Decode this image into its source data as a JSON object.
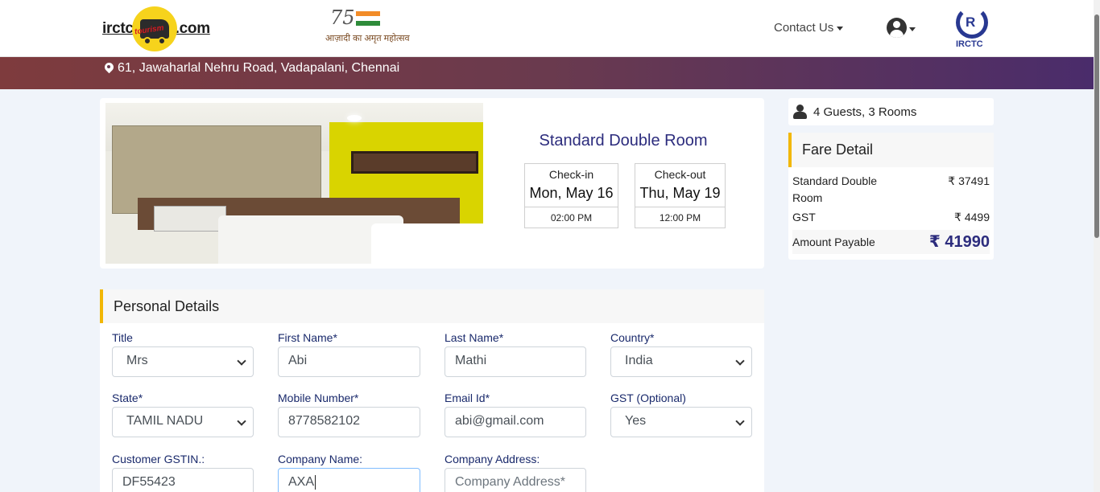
{
  "header": {
    "logo_left": {
      "prefix": "irctc",
      "suffix": ".com",
      "circle_word": "tourism"
    },
    "logo_azadi": {
      "number": "75",
      "caption": "आज़ादी का अमृत महोत्सव"
    },
    "contact_label": "Contact Us",
    "logo_right_label": "IRCTC",
    "logo_right_mark": "R"
  },
  "address": "61, Jawaharlal Nehru Road, Vadapalani, Chennai",
  "room": {
    "title": "Standard Double Room",
    "checkin": {
      "label": "Check-in",
      "date": "Mon, May 16",
      "time": "02:00 PM"
    },
    "checkout": {
      "label": "Check-out",
      "date": "Thu, May 19",
      "time": "12:00 PM"
    }
  },
  "guests": "4 Guests, 3 Rooms",
  "fare": {
    "title": "Fare Detail",
    "rows": [
      {
        "label": "Standard Double Room",
        "value": "₹ 37491"
      },
      {
        "label": "GST",
        "value": "₹ 4499"
      }
    ],
    "total_label": "Amount Payable",
    "total_value": "₹ 41990"
  },
  "personal": {
    "title": "Personal Details",
    "fields": {
      "title": {
        "label": "Title",
        "value": "Mrs"
      },
      "first_name": {
        "label": "First Name*",
        "value": "Abi"
      },
      "last_name": {
        "label": "Last Name*",
        "value": "Mathi"
      },
      "country": {
        "label": "Country*",
        "value": "India"
      },
      "state": {
        "label": "State*",
        "value": "TAMIL NADU"
      },
      "mobile": {
        "label": "Mobile Number*",
        "value": "8778582102"
      },
      "email": {
        "label": "Email Id*",
        "value": "abi@gmail.com"
      },
      "gst": {
        "label": "GST (Optional)",
        "value": "Yes"
      },
      "gstin": {
        "label": "Customer GSTIN.:",
        "value": "DF55423"
      },
      "company_name": {
        "label": "Company Name:",
        "value": "AXA"
      },
      "company_address": {
        "label": "Company Address:",
        "placeholder": "Company Address*"
      }
    }
  }
}
